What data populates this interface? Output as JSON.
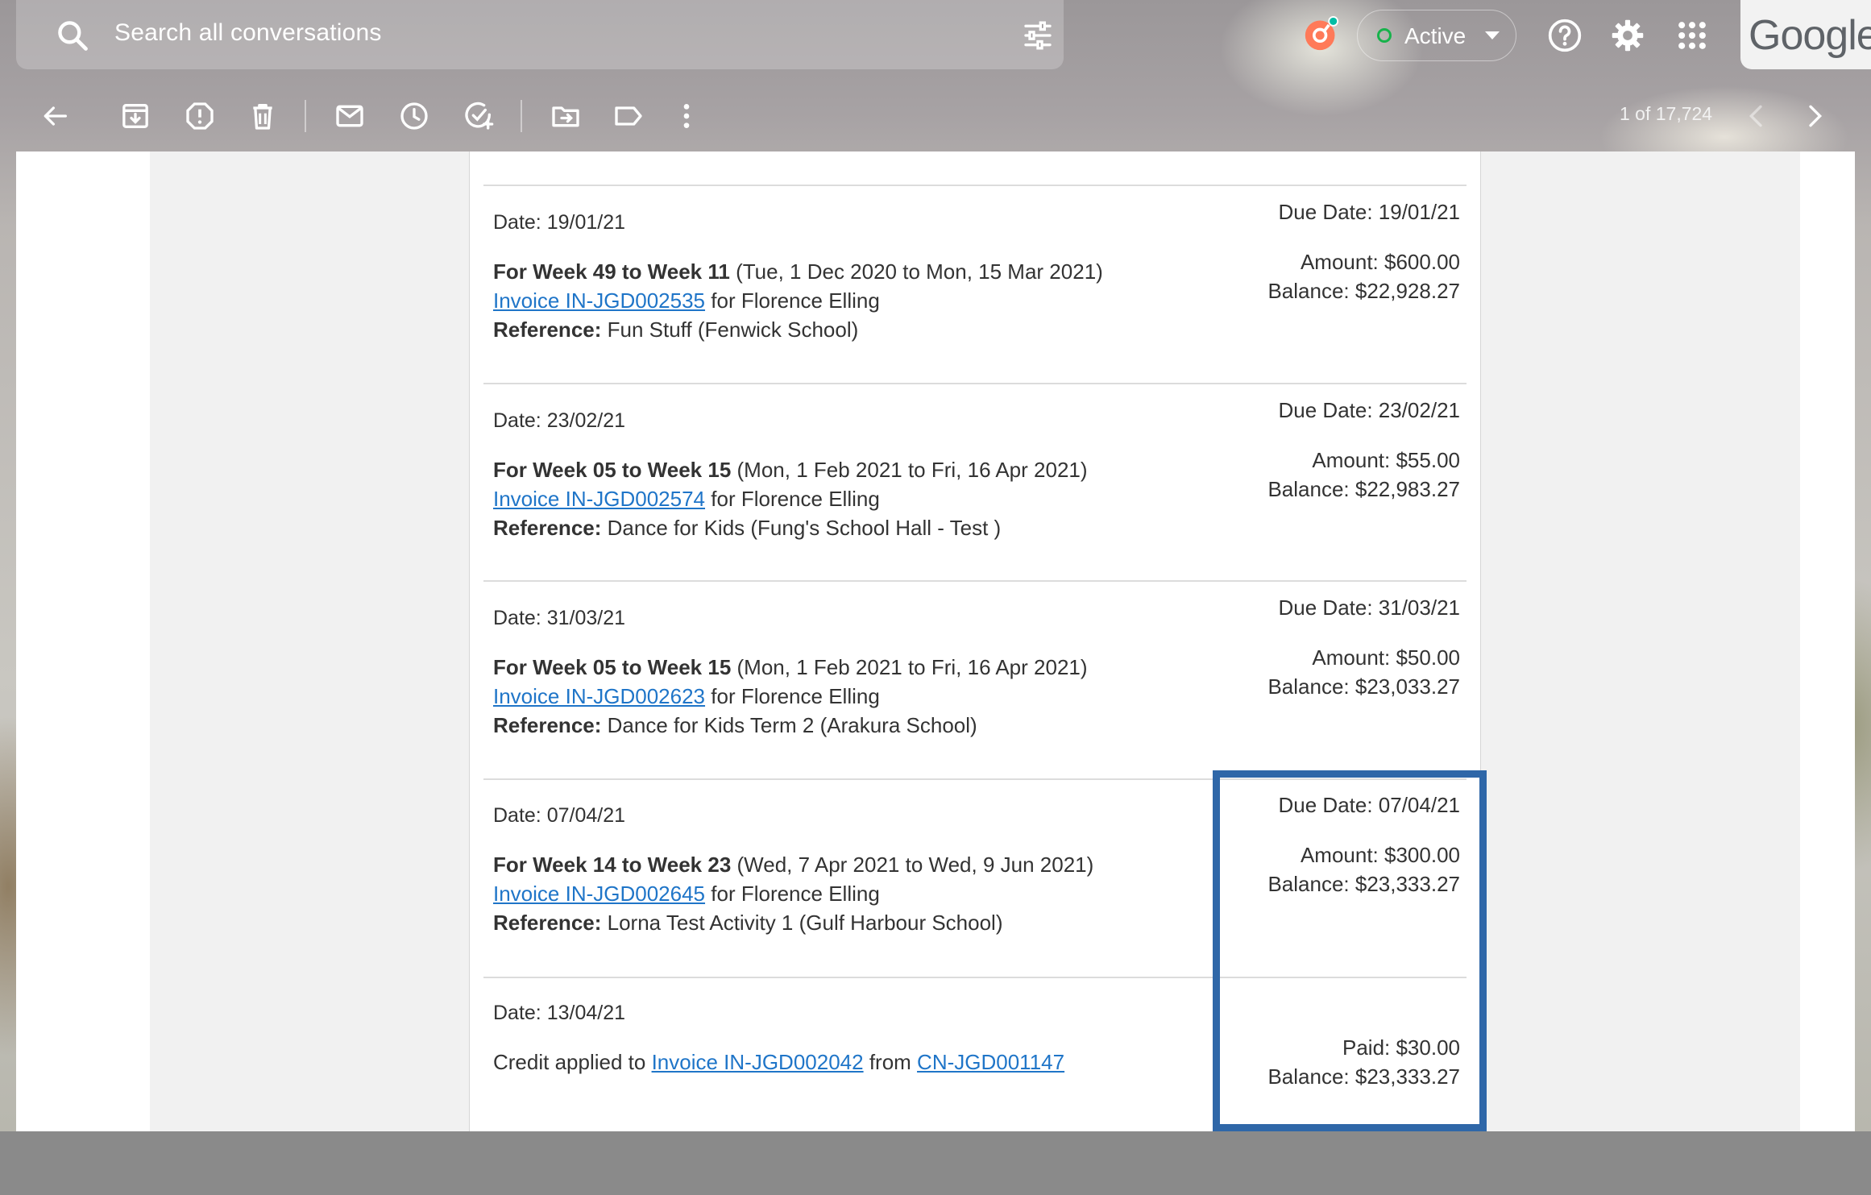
{
  "search": {
    "placeholder": "Search all conversations"
  },
  "status": {
    "label": "Active",
    "color": "#17b24b"
  },
  "brand": {
    "logo_text": "Google"
  },
  "icons": {
    "search": "search-icon",
    "filter": "tune-icon",
    "hubspot": "hubspot-icon",
    "help": "help-icon",
    "settings": "gear-icon",
    "apps": "apps-grid-icon"
  },
  "toolbar": {
    "actions": [
      "back",
      "archive",
      "report-spam",
      "delete",
      "mark-unread",
      "snooze",
      "add-to-tasks",
      "move-to",
      "labels",
      "more"
    ],
    "pager": "1 of 17,724"
  },
  "entries": [
    {
      "date": "Date: 19/01/21",
      "week_bold": "For Week 49 to Week 11",
      "week_rest": " (Tue, 1 Dec 2020 to Mon, 15 Mar 2021)",
      "invoice_link": "Invoice IN-JGD002535",
      "invoice_rest": " for Florence Elling",
      "ref_bold": "Reference:",
      "ref_rest": " Fun Stuff (Fenwick School)",
      "due": "Due Date: 19/01/21",
      "amount": "Amount: $600.00",
      "balance": "Balance: $22,928.27"
    },
    {
      "date": "Date: 23/02/21",
      "week_bold": "For Week 05 to Week 15",
      "week_rest": " (Mon, 1 Feb 2021 to Fri, 16 Apr 2021)",
      "invoice_link": "Invoice IN-JGD002574",
      "invoice_rest": " for Florence Elling",
      "ref_bold": "Reference:",
      "ref_rest": " Dance for Kids (Fung's School Hall - Test )",
      "due": "Due Date: 23/02/21",
      "amount": "Amount: $55.00",
      "balance": "Balance: $22,983.27"
    },
    {
      "date": "Date: 31/03/21",
      "week_bold": "For Week 05 to Week 15",
      "week_rest": " (Mon, 1 Feb 2021 to Fri, 16 Apr 2021)",
      "invoice_link": "Invoice IN-JGD002623",
      "invoice_rest": " for Florence Elling",
      "ref_bold": "Reference:",
      "ref_rest": " Dance for Kids Term 2 (Arakura School)",
      "due": "Due Date: 31/03/21",
      "amount": "Amount: $50.00",
      "balance": "Balance: $23,033.27"
    },
    {
      "date": "Date: 07/04/21",
      "week_bold": "For Week 14 to Week 23",
      "week_rest": " (Wed, 7 Apr 2021 to Wed, 9 Jun 2021)",
      "invoice_link": "Invoice IN-JGD002645",
      "invoice_rest": " for Florence Elling",
      "ref_bold": "Reference:",
      "ref_rest": " Lorna Test Activity 1 (Gulf Harbour School)",
      "due": "Due Date: 07/04/21",
      "amount": "Amount: $300.00",
      "balance": "Balance: $23,333.27"
    }
  ],
  "credit_entry": {
    "date": "Date: 13/04/21",
    "prefix": "Credit applied to ",
    "invoice_link": "Invoice IN-JGD002042",
    "middle": " from ",
    "credit_link": "CN-JGD001147",
    "paid": "Paid: $30.00",
    "balance": "Balance: $23,333.27"
  },
  "colors": {
    "link": "#1f75c8",
    "highlight": "#2f67a8"
  }
}
